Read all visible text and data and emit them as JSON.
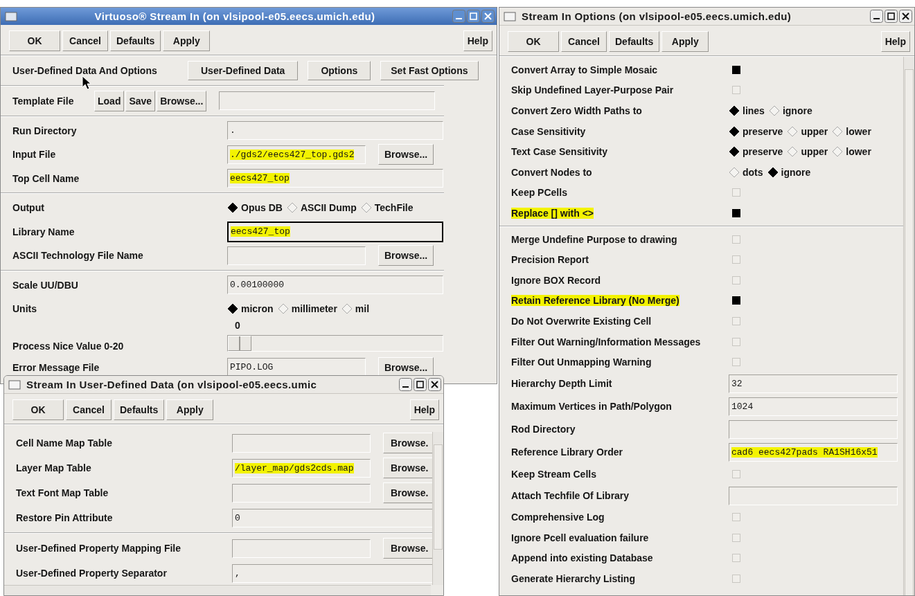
{
  "windows": [
    {
      "title": "Virtuoso® Stream In (on vlsipool-e05.eecs.umich.edu)",
      "active": true,
      "buttons": [
        "OK",
        "Cancel",
        "Defaults",
        "Apply"
      ],
      "help": "Help",
      "rows": [
        {
          "kind": "actions",
          "label": "User-Defined Data And Options",
          "buttons": [
            "User-Defined Data",
            "Options",
            "Set Fast Options"
          ]
        },
        {
          "kind": "separator"
        },
        {
          "kind": "template",
          "label": "Template File",
          "buttons": [
            "Load",
            "Save",
            "Browse..."
          ]
        },
        {
          "kind": "separator"
        },
        {
          "kind": "field",
          "label": "Run Directory",
          "value": ".",
          "highlighted": false
        },
        {
          "kind": "field",
          "label": "Input File",
          "value": "./gds2/eecs427_top.gds2",
          "highlighted": true,
          "browse": "Browse..."
        },
        {
          "kind": "field",
          "label": "Top Cell Name",
          "value": "eecs427_top",
          "highlighted": true
        },
        {
          "kind": "separator"
        },
        {
          "kind": "radio",
          "label": "Output",
          "options": [
            {
              "label": "Opus DB",
              "selected": true
            },
            {
              "label": "ASCII Dump",
              "selected": false
            },
            {
              "label": "TechFile",
              "selected": false
            }
          ]
        },
        {
          "kind": "field",
          "label": "Library Name",
          "value": "eecs427_top",
          "highlighted": true,
          "focused": true
        },
        {
          "kind": "field",
          "label": "ASCII Technology File Name",
          "browse": "Browse..."
        },
        {
          "kind": "separator"
        },
        {
          "kind": "field",
          "label": "Scale UU/DBU",
          "value": "0.00100000",
          "highlighted": false
        },
        {
          "kind": "radio",
          "label": "Units",
          "options": [
            {
              "label": "micron",
              "selected": true
            },
            {
              "label": "millimeter",
              "selected": false
            },
            {
              "label": "mil",
              "selected": false
            }
          ]
        },
        {
          "kind": "slider",
          "label": "Process Nice Value 0-20",
          "reading": "0",
          "level": 0
        },
        {
          "kind": "field",
          "label": "Error Message File",
          "value": "PIPO.LOG",
          "highlighted": false,
          "browse": "Browse..."
        }
      ]
    },
    {
      "title": "Stream In Options (on vlsipool-e05.eecs.umich.edu)",
      "active": false,
      "buttons": [
        "OK",
        "Cancel",
        "Defaults",
        "Apply"
      ],
      "help": "Help",
      "rows": [
        {
          "kind": "checkbox",
          "label": "Convert Array to Simple Mosaic",
          "checked": true,
          "highlighted": false
        },
        {
          "kind": "checkbox",
          "label": "Skip Undefined Layer-Purpose Pair",
          "checked": false,
          "highlighted": false
        },
        {
          "kind": "radio",
          "label": "Convert Zero Width Paths to",
          "options": [
            {
              "label": "lines",
              "selected": true
            },
            {
              "label": "ignore",
              "selected": false
            }
          ]
        },
        {
          "kind": "radio",
          "label": "Case Sensitivity",
          "options": [
            {
              "label": "preserve",
              "selected": true
            },
            {
              "label": "upper",
              "selected": false
            },
            {
              "label": "lower",
              "selected": false
            }
          ]
        },
        {
          "kind": "radio",
          "label": "Text Case Sensitivity",
          "options": [
            {
              "label": "preserve",
              "selected": true
            },
            {
              "label": "upper",
              "selected": false
            },
            {
              "label": "lower",
              "selected": false
            }
          ]
        },
        {
          "kind": "radio",
          "label": "Convert Nodes to",
          "options": [
            {
              "label": "dots",
              "selected": false
            },
            {
              "label": "ignore",
              "selected": true
            }
          ]
        },
        {
          "kind": "checkbox",
          "label": "Keep PCells",
          "checked": false,
          "highlighted": false
        },
        {
          "kind": "checkbox",
          "label": "Replace [] with <>",
          "checked": true,
          "highlighted": true
        },
        {
          "kind": "separator"
        },
        {
          "kind": "checkbox",
          "label": "Merge Undefine Purpose to drawing",
          "checked": false,
          "highlighted": false
        },
        {
          "kind": "checkbox",
          "label": "Precision Report",
          "checked": false,
          "highlighted": false
        },
        {
          "kind": "checkbox",
          "label": "Ignore BOX Record",
          "checked": false,
          "highlighted": false
        },
        {
          "kind": "checkbox",
          "label": "Retain Reference Library (No Merge)",
          "checked": true,
          "highlighted": true
        },
        {
          "kind": "checkbox",
          "label": "Do Not Overwrite Existing Cell",
          "checked": false,
          "highlighted": false
        },
        {
          "kind": "checkbox",
          "label": "Filter Out Warning/Information Messages",
          "checked": false,
          "highlighted": false
        },
        {
          "kind": "checkbox",
          "label": "Filter Out Unmapping Warning",
          "checked": false,
          "highlighted": false
        },
        {
          "kind": "field",
          "label": "Hierarchy Depth Limit",
          "value": "32",
          "highlighted": false
        },
        {
          "kind": "field",
          "label": "Maximum Vertices in Path/Polygon",
          "value": "1024",
          "highlighted": false
        },
        {
          "kind": "field",
          "label": "Rod Directory"
        },
        {
          "kind": "field",
          "label": "Reference Library Order",
          "value": "cad6 eecs427pads RA1SH16x51",
          "highlighted": true
        },
        {
          "kind": "checkbox",
          "label": "Keep Stream Cells",
          "checked": false,
          "highlighted": false
        },
        {
          "kind": "field",
          "label": "Attach Techfile Of Library"
        },
        {
          "kind": "checkbox",
          "label": "Comprehensive Log",
          "checked": false,
          "highlighted": false
        },
        {
          "kind": "checkbox",
          "label": "Ignore Pcell evaluation failure",
          "checked": false,
          "highlighted": false
        },
        {
          "kind": "checkbox",
          "label": "Append into existing Database",
          "checked": false,
          "highlighted": false
        },
        {
          "kind": "checkbox",
          "label": "Generate Hierarchy Listing",
          "checked": false,
          "highlighted": false
        }
      ]
    },
    {
      "title": "Stream In User-Defined Data (on vlsipool-e05.eecs.umic",
      "active": false,
      "buttons": [
        "OK",
        "Cancel",
        "Defaults",
        "Apply"
      ],
      "help": "Help",
      "rows": [
        {
          "kind": "field",
          "label": "Cell Name Map Table",
          "browse": "Browse."
        },
        {
          "kind": "field",
          "label": "Layer Map Table",
          "value": "/layer_map/gds2cds.map",
          "highlighted": true,
          "browse": "Browse."
        },
        {
          "kind": "field",
          "label": "Text Font Map Table",
          "browse": "Browse."
        },
        {
          "kind": "field",
          "label": "Restore Pin Attribute",
          "value": "0",
          "highlighted": false
        },
        {
          "kind": "separator"
        },
        {
          "kind": "field",
          "label": "User-Defined Property Mapping File",
          "browse": "Browse."
        },
        {
          "kind": "field",
          "label": "User-Defined Property Separator",
          "value": ",",
          "highlighted": false
        }
      ]
    }
  ]
}
